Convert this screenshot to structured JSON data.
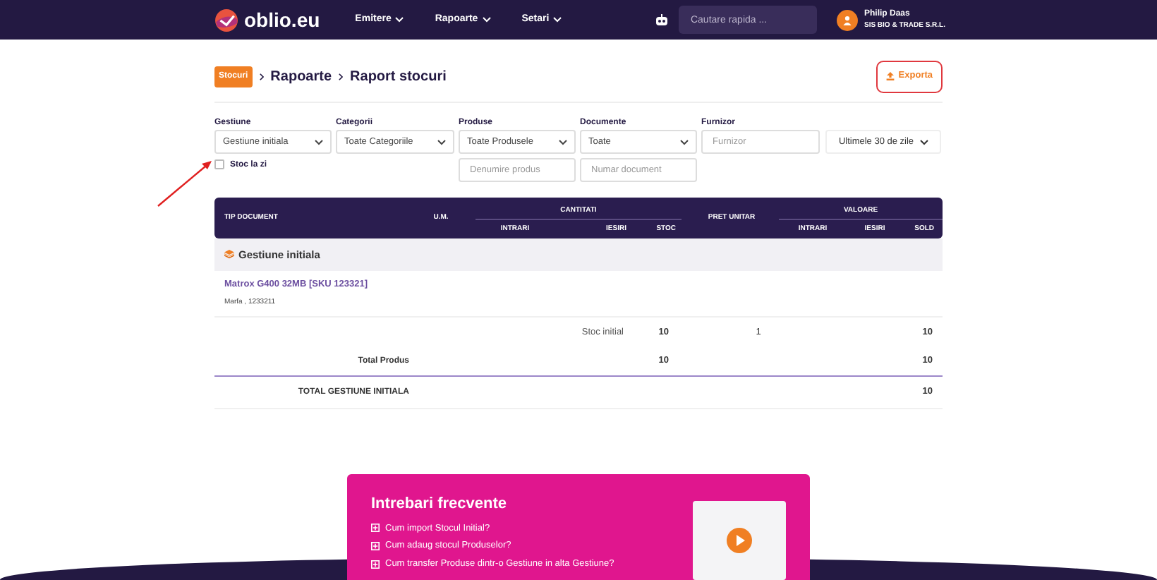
{
  "navbar": {
    "logo": "oblio.eu",
    "menu": [
      {
        "label": "Emitere"
      },
      {
        "label": "Rapoarte"
      },
      {
        "label": "Setari"
      }
    ],
    "search": {
      "placeholder": "Cautare rapida ..."
    },
    "user": {
      "name": "Philip Daas",
      "company": "SIS BIO & TRADE S.R.L."
    }
  },
  "breadcrumb": {
    "badge": "Stocuri",
    "items": [
      "Rapoarte",
      "Raport stocuri"
    ]
  },
  "export_button": {
    "label": "Exporta"
  },
  "filters": [
    {
      "label": "Gestiune",
      "kind": "select",
      "value": "Gestiune initiala"
    },
    {
      "label": "Categorii",
      "kind": "select",
      "value": "Toate Categoriile"
    },
    {
      "label": "Produse",
      "kind": "select",
      "value": "Toate Produsele"
    },
    {
      "label": "Documente",
      "kind": "select",
      "value": "Toate"
    },
    {
      "label": "Furnizor",
      "kind": "input",
      "placeholder": "Furnizor"
    },
    {
      "kind": "period",
      "value": "Ultimele 30 de zile"
    }
  ],
  "stock_to_date": {
    "label": "Stoc la zi",
    "checked": false
  },
  "search_fields": [
    {
      "placeholder": "Denumire produs"
    },
    {
      "placeholder": "Numar document"
    }
  ],
  "table": {
    "columns": [
      "TIP DOCUMENT",
      "U.M.",
      "INTRARI",
      "IESIRI",
      "STOC",
      "PRET UNITAR",
      "INTRARI",
      "IESIRI",
      "SOLD"
    ],
    "groups": [
      "CANTITATI",
      "VALOARE"
    ],
    "section": "Gestiune initiala",
    "product": {
      "name": "Matrox G400 32MB [SKU 123321]",
      "detail": "Marfa , 1233211"
    },
    "rows": [
      {
        "kind": "entry",
        "label": "Stoc initial",
        "stock": "10",
        "unit_price": "1",
        "balance": "10"
      },
      {
        "kind": "product_total",
        "label": "Total Produs",
        "stock": "10",
        "balance": "10"
      },
      {
        "kind": "section_total",
        "label": "TOTAL GESTIUNE INITIALA",
        "balance": "10"
      }
    ]
  },
  "faq": {
    "title": "Intrebari frecvente",
    "questions": [
      "Cum import Stocul Initial?",
      "Cum adaug stocul Produselor?",
      "Cum transfer Produse dintr-o Gestiune in alta Gestiune?"
    ]
  }
}
